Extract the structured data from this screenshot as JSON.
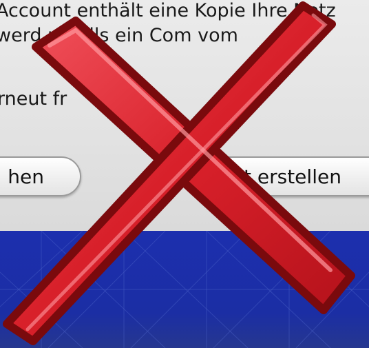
{
  "dialog": {
    "line1": "Account enthält eine Kopie Ihre Netz",
    "line2": "werd       n, falls ein Com        vom",
    "line3": "rneut fr",
    "button_left_label": "hen",
    "button_right_label": "t erstellen"
  },
  "overlay": {
    "icon": "cross-icon",
    "color": "#d8202a",
    "outline_color": "#7a0a0d"
  },
  "desktop": {
    "color": "#1c2fae"
  }
}
